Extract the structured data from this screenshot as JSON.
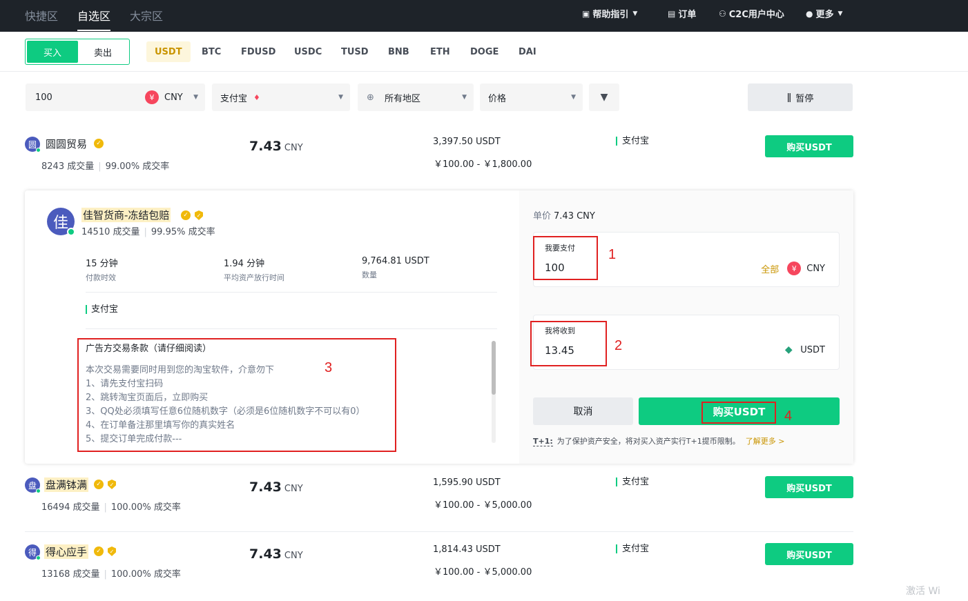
{
  "topnav": {
    "zones": [
      "快捷区",
      "自选区",
      "大宗区"
    ],
    "help": "帮助指引",
    "orders": "订单",
    "c2c_center": "C2C用户中心",
    "more": "更多"
  },
  "trade": {
    "buy": "买入",
    "sell": "卖出",
    "coins": [
      "USDT",
      "BTC",
      "FDUSD",
      "USDC",
      "TUSD",
      "BNB",
      "ETH",
      "DOGE",
      "DAI"
    ],
    "active_coin": "USDT"
  },
  "filters": {
    "amount": "100",
    "currency": "CNY",
    "payment": "支付宝",
    "region": "所有地区",
    "sort": "价格",
    "pause": "暂停"
  },
  "listings": [
    {
      "avatar": "圆",
      "name": "圆圆贸易",
      "trades": "8243 成交量",
      "rate": "99.00% 成交率",
      "price": "7.43",
      "currency": "CNY",
      "available": "3,397.50 USDT",
      "limit": "￥100.00 - ￥1,800.00",
      "payment": "支付宝",
      "button": "购买USDT"
    },
    {
      "avatar": "盘",
      "name": "盘满钵满",
      "trades": "16494 成交量",
      "rate": "100.00% 成交率",
      "price": "7.43",
      "currency": "CNY",
      "available": "1,595.90 USDT",
      "limit": "￥100.00 - ￥5,000.00",
      "payment": "支付宝",
      "button": "购买USDT"
    },
    {
      "avatar": "得",
      "name": "得心应手",
      "trades": "13168 成交量",
      "rate": "100.00% 成交率",
      "price": "7.43",
      "currency": "CNY",
      "available": "1,814.43 USDT",
      "limit": "￥100.00 - ￥5,000.00",
      "payment": "支付宝",
      "button": "购买USDT"
    }
  ],
  "panel": {
    "avatar": "佳",
    "name": "佳智货商-冻结包赔",
    "trades": "14510 成交量",
    "rate": "99.95% 成交率",
    "metrics": [
      {
        "value": "15 分钟",
        "label": "付款时效"
      },
      {
        "value": "1.94 分钟",
        "label": "平均资产放行时间"
      },
      {
        "value": "9,764.81 USDT",
        "label": "数量"
      }
    ],
    "payment": "支付宝",
    "terms_title": "广告方交易条款（请仔细阅读）",
    "terms": [
      "本次交易需要同时用到您的淘宝软件，介意勿下",
      "1、请先支付宝扫码",
      "2、跳转淘宝页面后，立即购买",
      "3、QQ处必须填写任意6位随机数字（必须是6位随机数字不可以有0）",
      "4、在订单备注那里填写你的真实姓名",
      "5、提交订单完成付款---"
    ],
    "unit_label": "单价",
    "unit_price": "7.43 CNY",
    "pay_label": "我要支付",
    "pay_value": "100",
    "all": "全部",
    "pay_currency": "CNY",
    "receive_label": "我将收到",
    "receive_value": "13.45",
    "receive_currency": "USDT",
    "cancel": "取消",
    "confirm": "购买USDT",
    "tnote_tag": "T+1:",
    "tnote": "为了保护资产安全，将对买入资产实行T+1提币限制。",
    "learn_more": "了解更多 >"
  },
  "annotations": [
    "1",
    "2",
    "3",
    "4"
  ],
  "watermark": "激活 Wi",
  "colors": {
    "accent": "#0ecb81",
    "brand_yellow": "#f0b90b",
    "annotation_red": "#e02020",
    "nav_bg": "#1e2329"
  }
}
